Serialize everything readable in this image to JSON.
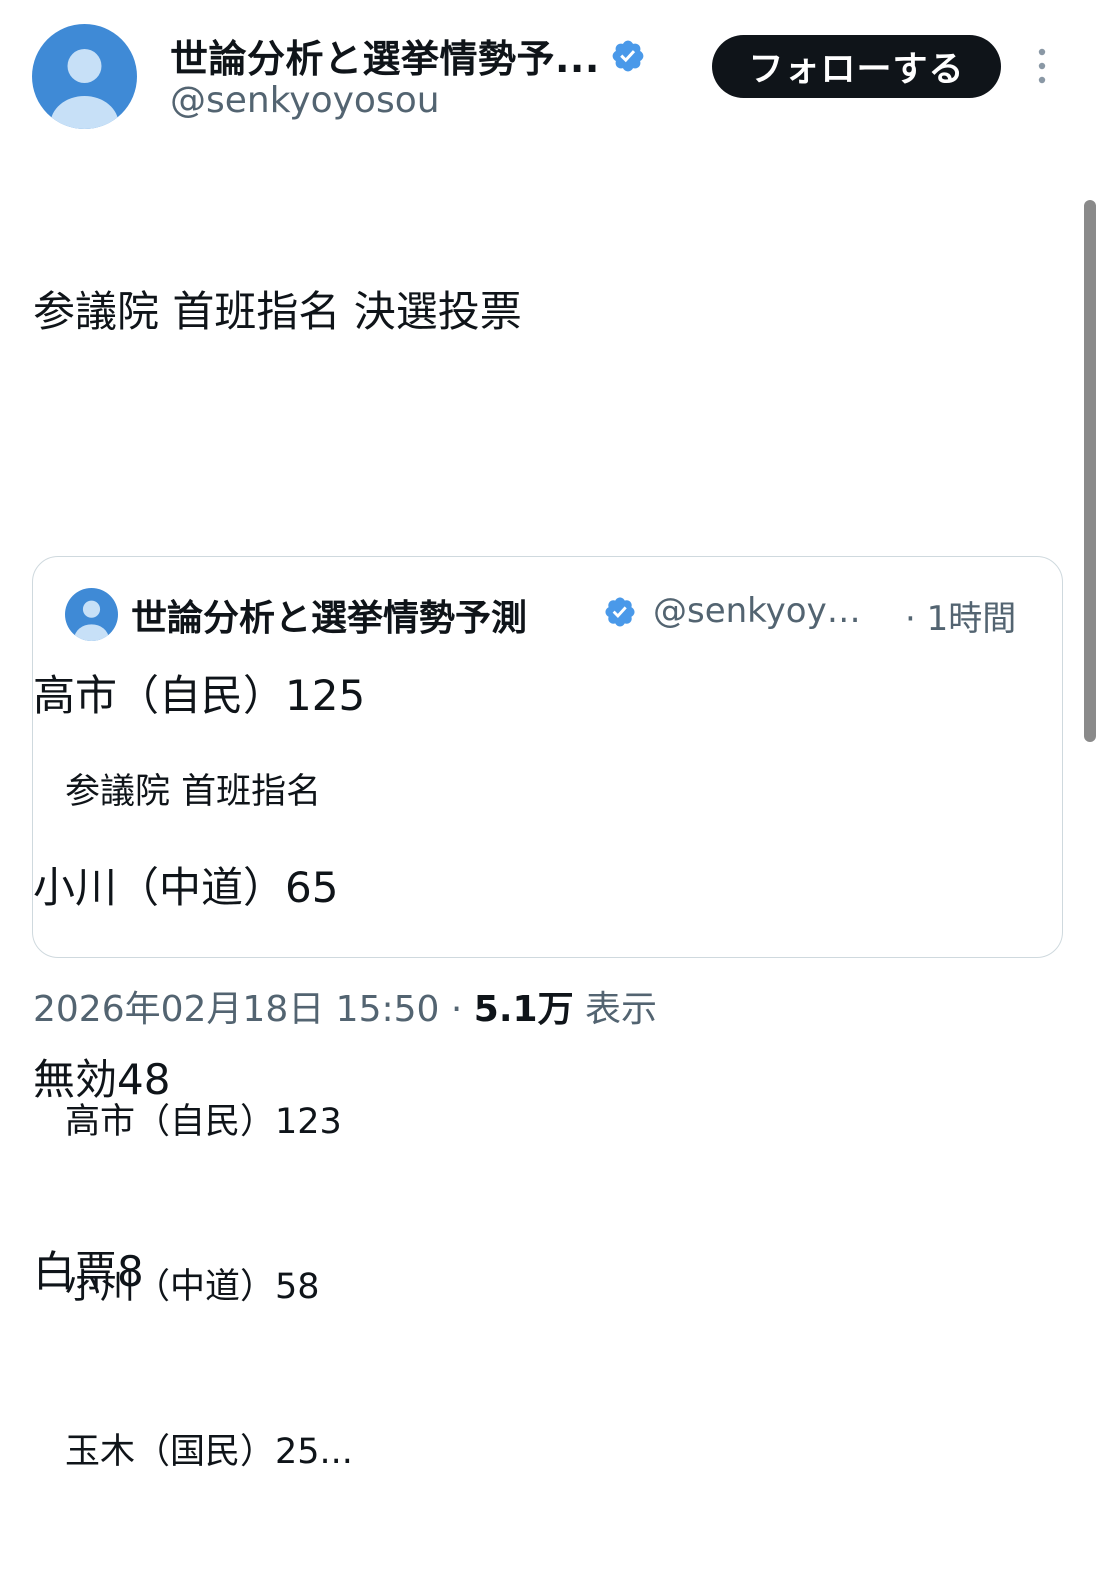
{
  "author": {
    "display_name": "世論分析と選挙情勢予...",
    "handle": "@senkyoyosou",
    "avatar_icon": "default-avatar-icon",
    "verified_icon": "verified-badge-icon",
    "verified_color": "#4a99e9"
  },
  "actions": {
    "follow_label": "フォローする",
    "more_icon": "more-vertical-icon"
  },
  "post": {
    "lines": [
      "参議院 首班指名 決選投票",
      "",
      "高市（自民）125",
      "小川（中道）65",
      "無効48",
      "白票8"
    ]
  },
  "quoted_post": {
    "display_name": "世論分析と選挙情勢予測",
    "handle": "@senkyoy…",
    "time": "· 1時間",
    "lines": [
      "参議院 首班指名",
      "",
      "高市（自民）123",
      "小川（中道）58",
      "玉木（国民）25..."
    ]
  },
  "meta": {
    "timestamp": "2026年02月18日 15:50",
    "separator": "·",
    "views_count": "5.1万",
    "views_label": "表示"
  },
  "colors": {
    "text_primary": "#0f1419",
    "text_secondary": "#536471",
    "avatar_bg": "#3f8ad6",
    "button_bg": "#0f1419",
    "border": "#cfd9de"
  }
}
